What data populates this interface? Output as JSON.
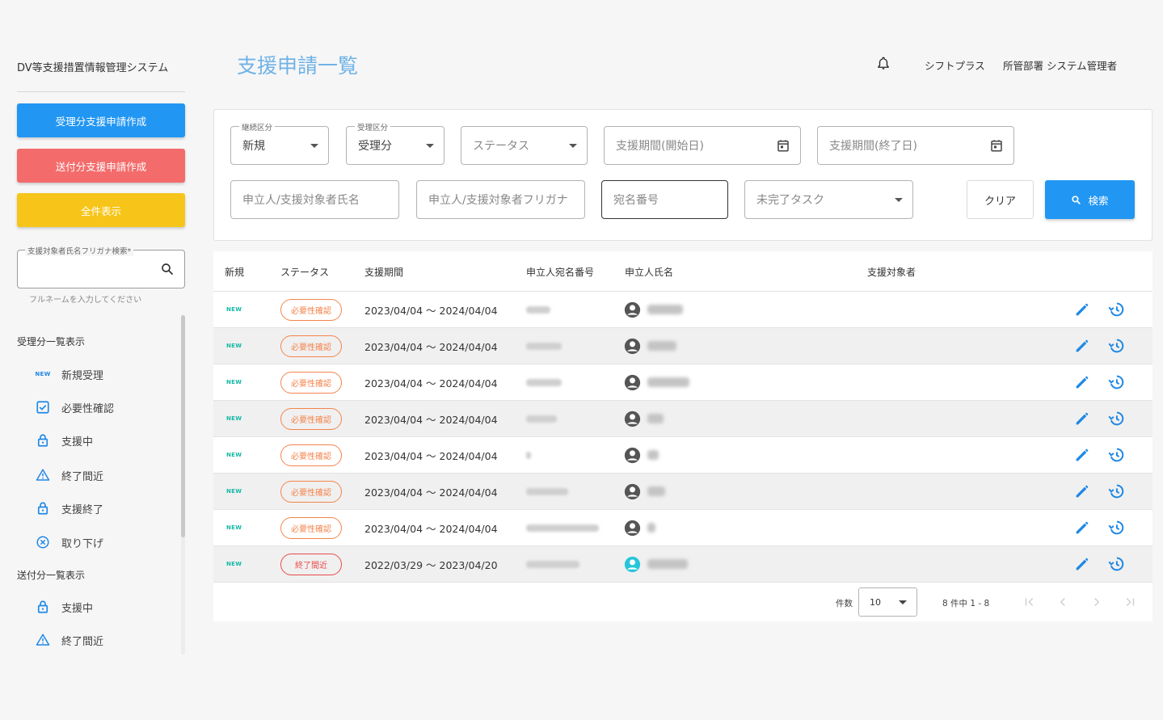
{
  "app": {
    "title": "DV等支援措置情報管理システム"
  },
  "sidebar": {
    "buttons": {
      "create_received": "受理分支援申請作成",
      "create_sent": "送付分支援申請作成",
      "show_all": "全件表示"
    },
    "search": {
      "legend": "支援対象者氏名フリガナ検索*",
      "hint": "フルネームを入力してください"
    },
    "received_heading": "受理分一覧表示",
    "received_items": [
      {
        "label": "新規受理",
        "icon": "new-icon"
      },
      {
        "label": "必要性確認",
        "icon": "checkbox-icon"
      },
      {
        "label": "支援中",
        "icon": "lock-icon"
      },
      {
        "label": "終了間近",
        "icon": "warning-icon"
      },
      {
        "label": "支援終了",
        "icon": "lock-icon"
      },
      {
        "label": "取り下げ",
        "icon": "cancel-icon"
      }
    ],
    "sent_heading": "送付分一覧表示",
    "sent_items": [
      {
        "label": "支援中",
        "icon": "lock-icon"
      },
      {
        "label": "終了間近",
        "icon": "warning-icon"
      }
    ],
    "new_tag": "NEW"
  },
  "header": {
    "page_title": "支援申請一覧",
    "org": "シフトプラス",
    "user": "所管部署 システム管理者"
  },
  "filters": {
    "continuation": {
      "legend": "継続区分",
      "value": "新規"
    },
    "receipt": {
      "legend": "受理区分",
      "value": "受理分"
    },
    "status": {
      "placeholder": "ステータス"
    },
    "period_start": {
      "placeholder": "支援期間(開始日)"
    },
    "period_end": {
      "placeholder": "支援期間(終了日)"
    },
    "applicant_name": {
      "placeholder": "申立人/支援対象者氏名"
    },
    "applicant_kana": {
      "placeholder": "申立人/支援対象者フリガナ"
    },
    "address_number": {
      "placeholder": "宛名番号"
    },
    "incomplete_task": {
      "placeholder": "未完了タスク"
    },
    "clear_label": "クリア",
    "search_label": "検索"
  },
  "table": {
    "headers": {
      "new": "新規",
      "status": "ステータス",
      "period": "支援期間",
      "address_no": "申立人宛名番号",
      "applicant": "申立人氏名",
      "target": "支援対象者"
    },
    "rows": [
      {
        "new": "NEW",
        "status": "必要性確認",
        "status_color": "#f4844c",
        "period": "2023/04/04 ～ 2024/04/04"
      },
      {
        "new": "NEW",
        "status": "必要性確認",
        "status_color": "#f4844c",
        "period": "2023/04/04 ～ 2024/04/04"
      },
      {
        "new": "NEW",
        "status": "必要性確認",
        "status_color": "#f4844c",
        "period": "2023/04/04 ～ 2024/04/04"
      },
      {
        "new": "NEW",
        "status": "必要性確認",
        "status_color": "#f4844c",
        "period": "2023/04/04 ～ 2024/04/04"
      },
      {
        "new": "NEW",
        "status": "必要性確認",
        "status_color": "#f4844c",
        "period": "2023/04/04 ～ 2024/04/04"
      },
      {
        "new": "NEW",
        "status": "必要性確認",
        "status_color": "#f4844c",
        "period": "2023/04/04 ～ 2024/04/04"
      },
      {
        "new": "NEW",
        "status": "必要性確認",
        "status_color": "#f4844c",
        "period": "2023/04/04 ～ 2024/04/04"
      },
      {
        "new": "NEW",
        "status": "終了間近",
        "status_color": "#ea4a4a",
        "period": "2022/03/29 ～ 2023/04/20"
      }
    ]
  },
  "pagination": {
    "count_label": "件数",
    "page_size": "10",
    "range": "8 件中 1 - 8"
  },
  "colors": {
    "primary": "#2196f3",
    "danger": "#f46b6b",
    "warning": "#f7c51a",
    "title": "#6fb3e6",
    "new_tag": "#14b8a6"
  }
}
